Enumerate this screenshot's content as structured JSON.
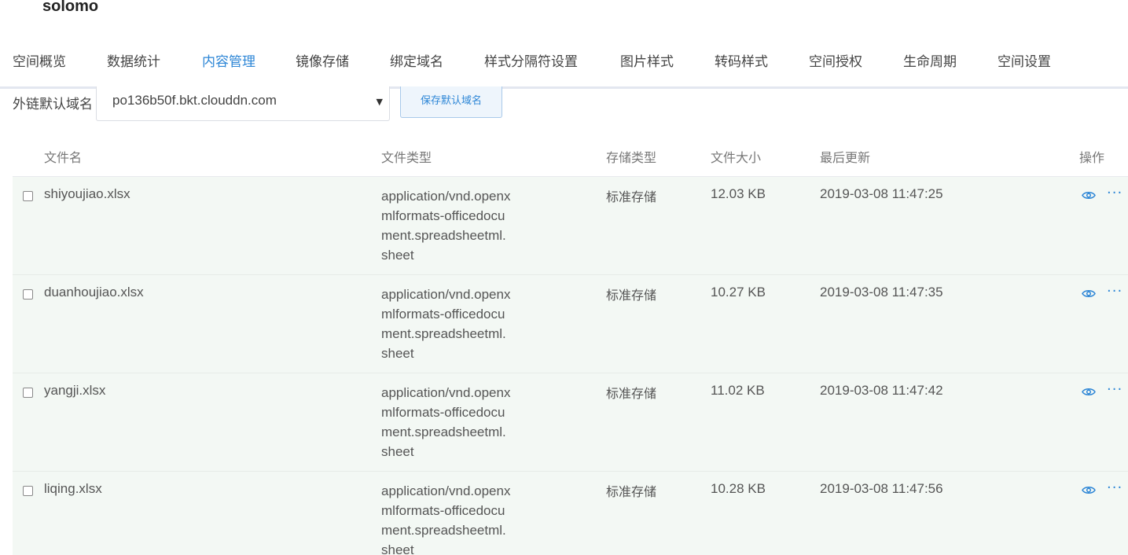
{
  "bucket": {
    "name": "solomo"
  },
  "tabs": [
    {
      "label": "空间概览"
    },
    {
      "label": "数据统计"
    },
    {
      "label": "内容管理"
    },
    {
      "label": "镜像存储"
    },
    {
      "label": "绑定域名"
    },
    {
      "label": "样式分隔符设置"
    },
    {
      "label": "图片样式"
    },
    {
      "label": "转码样式"
    },
    {
      "label": "空间授权"
    },
    {
      "label": "生命周期"
    },
    {
      "label": "空间设置"
    }
  ],
  "active_tab": "内容管理",
  "domain": {
    "label": "外链默认域名",
    "selected": "po136b50f.bkt.clouddn.com",
    "save_label": "保存默认域名"
  },
  "table": {
    "headers": {
      "name": "文件名",
      "type": "文件类型",
      "storage": "存储类型",
      "size": "文件大小",
      "updated": "最后更新",
      "actions": "操作"
    },
    "rows": [
      {
        "name": "shiyoujiao.xlsx",
        "type": "application/vnd.openxmlformats-officedocument.spreadsheetml.sheet",
        "storage": "标准存储",
        "size": "12.03 KB",
        "updated": "2019-03-08 11:47:25"
      },
      {
        "name": "duanhoujiao.xlsx",
        "type": "application/vnd.openxmlformats-officedocument.spreadsheetml.sheet",
        "storage": "标准存储",
        "size": "10.27 KB",
        "updated": "2019-03-08 11:47:35"
      },
      {
        "name": "yangji.xlsx",
        "type": "application/vnd.openxmlformats-officedocument.spreadsheetml.sheet",
        "storage": "标准存储",
        "size": "11.02 KB",
        "updated": "2019-03-08 11:47:42"
      },
      {
        "name": "liqing.xlsx",
        "type": "application/vnd.openxmlformats-officedocument.spreadsheetml.sheet",
        "storage": "标准存储",
        "size": "10.28 KB",
        "updated": "2019-03-08 11:47:56"
      }
    ]
  },
  "icons": {
    "view": "eye-icon",
    "more": "more-icon",
    "dropdown": "caret-down-icon"
  },
  "colors": {
    "accent": "#2d86d6",
    "row_background": "#f3f8f4"
  }
}
